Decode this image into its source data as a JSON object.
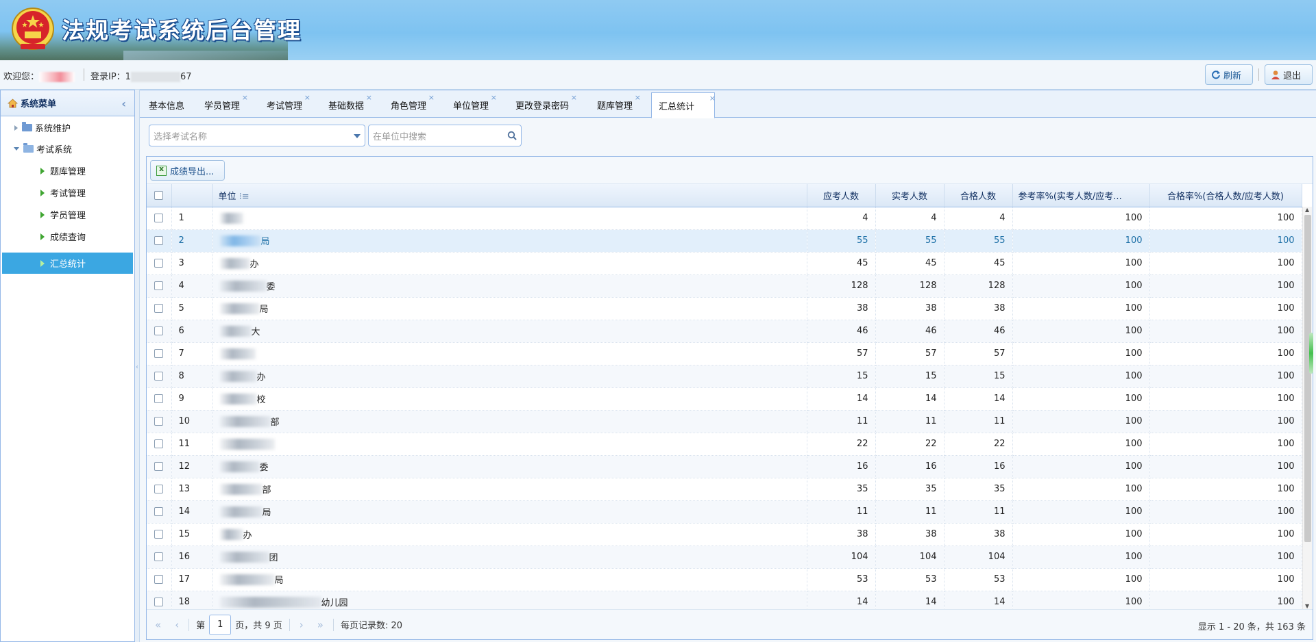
{
  "app": {
    "title": "法规考试系统后台管理"
  },
  "topbar": {
    "welcome_label": "欢迎您：",
    "login_ip_label": "登录IP：1",
    "login_ip_tail": "67",
    "refresh_label": "刷新",
    "logout_label": "退出"
  },
  "sidebar": {
    "title": "系统菜单",
    "items": [
      {
        "label": "系统维护",
        "level": 0,
        "expanded": false
      },
      {
        "label": "考试系统",
        "level": 0,
        "expanded": true
      },
      {
        "label": "题库管理",
        "level": 1
      },
      {
        "label": "考试管理",
        "level": 1
      },
      {
        "label": "学员管理",
        "level": 1
      },
      {
        "label": "成绩查询",
        "level": 1
      },
      {
        "label": "汇总统计",
        "level": 1,
        "active": true
      }
    ]
  },
  "tabs": [
    {
      "label": "基本信息",
      "closable": false
    },
    {
      "label": "学员管理",
      "closable": true
    },
    {
      "label": "考试管理",
      "closable": true
    },
    {
      "label": "基础数据",
      "closable": true
    },
    {
      "label": "角色管理",
      "closable": true
    },
    {
      "label": "单位管理",
      "closable": true
    },
    {
      "label": "更改登录密码",
      "closable": true
    },
    {
      "label": "题库管理",
      "closable": true
    },
    {
      "label": "汇总统计",
      "closable": true,
      "active": true
    }
  ],
  "filters": {
    "exam_placeholder": "选择考试名称",
    "unit_search_placeholder": "在单位中搜索"
  },
  "toolbar": {
    "export_label": "成绩导出..."
  },
  "table": {
    "columns": [
      "单位",
      "应考人数",
      "实考人数",
      "合格人数",
      "参考率%(实考人数/应考...",
      "合格率%(合格人数/应考人数)"
    ],
    "sort_icon": "sort-asc-icon",
    "rows": [
      {
        "no": "1",
        "unit_tail": "",
        "expected": "4",
        "actual": "4",
        "passed": "4",
        "attend_rate": "100",
        "pass_rate": "100"
      },
      {
        "no": "2",
        "unit_tail": "局",
        "expected": "55",
        "actual": "55",
        "passed": "55",
        "attend_rate": "100",
        "pass_rate": "100",
        "highlight": true
      },
      {
        "no": "3",
        "unit_tail": "办",
        "expected": "45",
        "actual": "45",
        "passed": "45",
        "attend_rate": "100",
        "pass_rate": "100"
      },
      {
        "no": "4",
        "unit_tail": "委",
        "expected": "128",
        "actual": "128",
        "passed": "128",
        "attend_rate": "100",
        "pass_rate": "100"
      },
      {
        "no": "5",
        "unit_tail": "局",
        "expected": "38",
        "actual": "38",
        "passed": "38",
        "attend_rate": "100",
        "pass_rate": "100"
      },
      {
        "no": "6",
        "unit_tail": "大",
        "expected": "46",
        "actual": "46",
        "passed": "46",
        "attend_rate": "100",
        "pass_rate": "100"
      },
      {
        "no": "7",
        "unit_tail": "",
        "expected": "57",
        "actual": "57",
        "passed": "57",
        "attend_rate": "100",
        "pass_rate": "100"
      },
      {
        "no": "8",
        "unit_tail": "办",
        "expected": "15",
        "actual": "15",
        "passed": "15",
        "attend_rate": "100",
        "pass_rate": "100"
      },
      {
        "no": "9",
        "unit_tail": "校",
        "expected": "14",
        "actual": "14",
        "passed": "14",
        "attend_rate": "100",
        "pass_rate": "100"
      },
      {
        "no": "10",
        "unit_tail": "部",
        "expected": "11",
        "actual": "11",
        "passed": "11",
        "attend_rate": "100",
        "pass_rate": "100"
      },
      {
        "no": "11",
        "unit_tail": "",
        "expected": "22",
        "actual": "22",
        "passed": "22",
        "attend_rate": "100",
        "pass_rate": "100"
      },
      {
        "no": "12",
        "unit_tail": "委",
        "expected": "16",
        "actual": "16",
        "passed": "16",
        "attend_rate": "100",
        "pass_rate": "100"
      },
      {
        "no": "13",
        "unit_tail": "部",
        "expected": "35",
        "actual": "35",
        "passed": "35",
        "attend_rate": "100",
        "pass_rate": "100"
      },
      {
        "no": "14",
        "unit_tail": "局",
        "expected": "11",
        "actual": "11",
        "passed": "11",
        "attend_rate": "100",
        "pass_rate": "100"
      },
      {
        "no": "15",
        "unit_tail": "办",
        "expected": "38",
        "actual": "38",
        "passed": "38",
        "attend_rate": "100",
        "pass_rate": "100"
      },
      {
        "no": "16",
        "unit_tail": "团",
        "expected": "104",
        "actual": "104",
        "passed": "104",
        "attend_rate": "100",
        "pass_rate": "100"
      },
      {
        "no": "17",
        "unit_tail": "局",
        "expected": "53",
        "actual": "53",
        "passed": "53",
        "attend_rate": "100",
        "pass_rate": "100"
      },
      {
        "no": "18",
        "unit_tail": "幼儿园",
        "expected": "14",
        "actual": "14",
        "passed": "14",
        "attend_rate": "100",
        "pass_rate": "100"
      }
    ]
  },
  "pager": {
    "page_prefix": "第",
    "page_value": "1",
    "page_suffix": "页，共 9 页",
    "page_size_label": "每页记录数: 20",
    "summary": "显示 1 - 20 条，共 163 条"
  },
  "colors": {
    "accent": "#3ba7e2",
    "border": "#95b8e7",
    "banner": "#7ec3f1"
  }
}
